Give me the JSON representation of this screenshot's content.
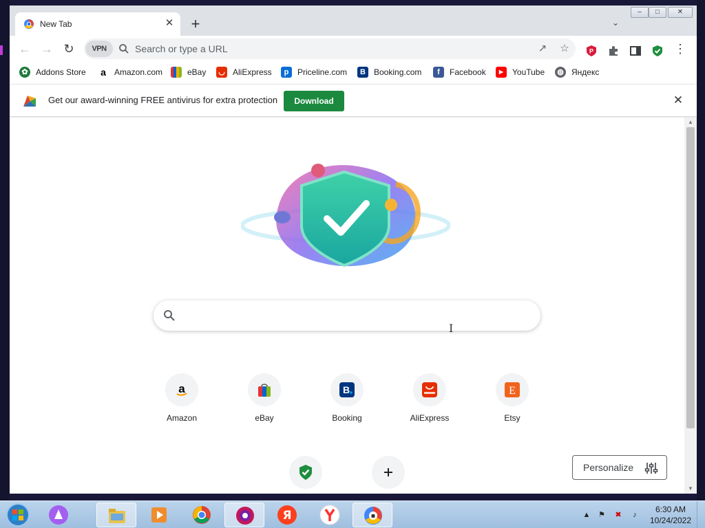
{
  "window": {
    "tab_title": "New Tab",
    "controls": {
      "minimize": "‒",
      "maximize": "□",
      "close": "✕"
    }
  },
  "toolbar": {
    "vpn_label": "VPN",
    "address_placeholder": "Search or type a URL"
  },
  "bookmarks": [
    {
      "label": "Addons Store",
      "icon": "addons-store-icon",
      "color": "#1e7a3c"
    },
    {
      "label": "Amazon.com",
      "icon": "amazon-icon",
      "color": "#000000"
    },
    {
      "label": "eBay",
      "icon": "ebay-icon",
      "color": "#e53238"
    },
    {
      "label": "AliExpress",
      "icon": "aliexpress-icon",
      "color": "#e62e04"
    },
    {
      "label": "Priceline.com",
      "icon": "priceline-icon",
      "color": "#0a6dd8"
    },
    {
      "label": "Booking.com",
      "icon": "booking-icon",
      "color": "#003580"
    },
    {
      "label": "Facebook",
      "icon": "facebook-icon",
      "color": "#3b5998"
    },
    {
      "label": "YouTube",
      "icon": "youtube-icon",
      "color": "#ff0000"
    },
    {
      "label": "Яндекс",
      "icon": "globe-icon",
      "color": "#5f6368"
    }
  ],
  "infobar": {
    "message": "Get our award-winning FREE antivirus for extra protection",
    "button": "Download"
  },
  "ntp": {
    "tiles": [
      {
        "label": "Amazon",
        "logo_text": "a",
        "color": "#000000"
      },
      {
        "label": "eBay",
        "logo_text": "",
        "color": "#e53238"
      },
      {
        "label": "Booking",
        "logo_text": "B.",
        "color": "#003580"
      },
      {
        "label": "AliExpress",
        "logo_text": "AliExpress",
        "color": "#e62e04"
      },
      {
        "label": "Etsy",
        "logo_text": "E",
        "color": "#f1641e"
      }
    ],
    "personalize": "Personalize"
  },
  "taskbar": {
    "time": "6:30 AM",
    "date": "10/24/2022"
  },
  "colors": {
    "accent_green": "#1b8a3e",
    "tab_strip": "#dee1e6"
  }
}
